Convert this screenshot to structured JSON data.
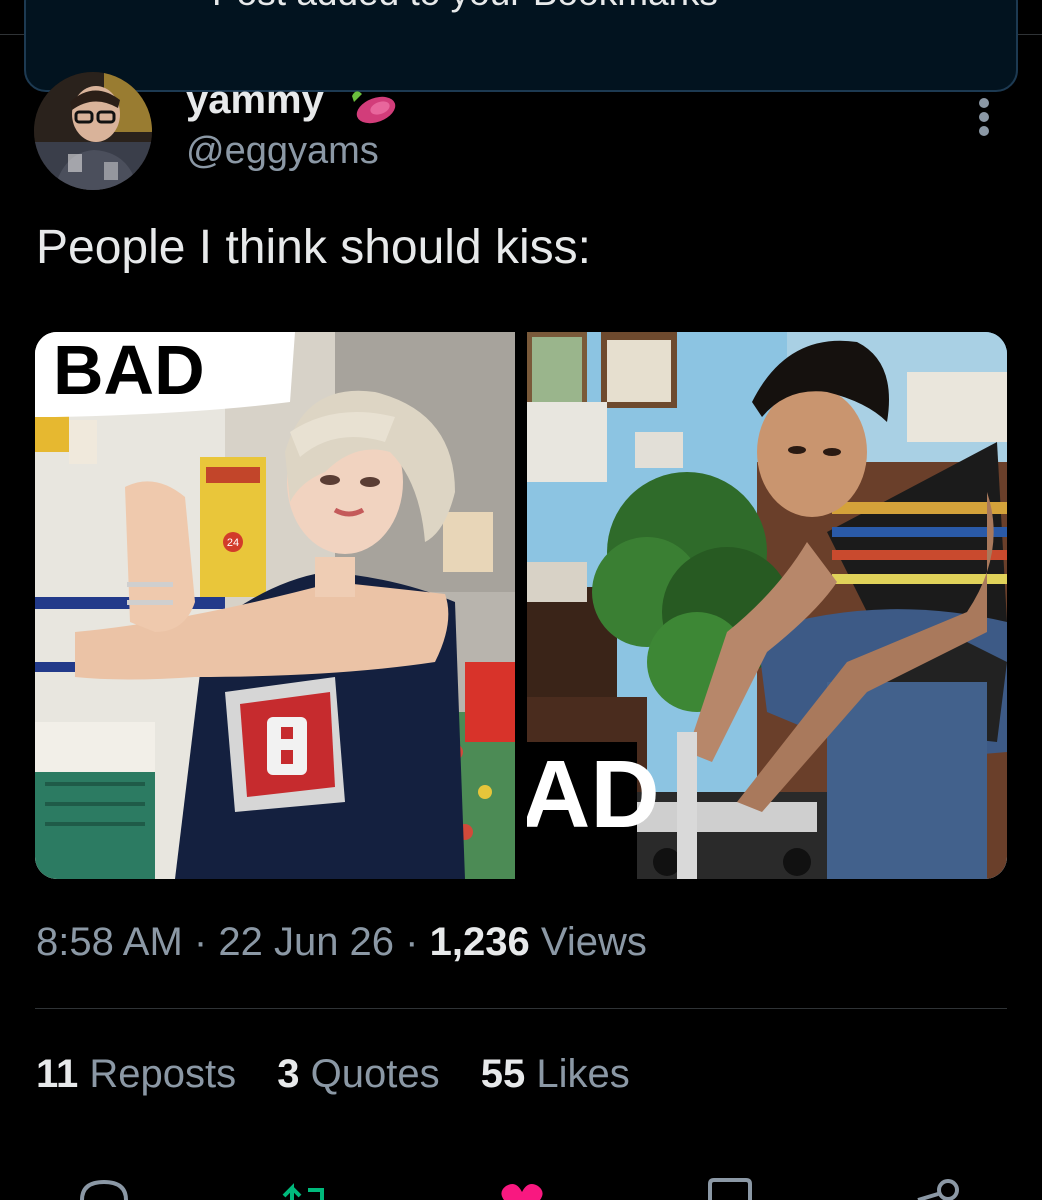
{
  "toast": {
    "message": "Post added to your Bookmarks",
    "icon": "check-circle-icon"
  },
  "author": {
    "display_name": "yammy",
    "name_emoji": "sweet-potato-emoji",
    "handle": "@eggyams"
  },
  "tweet": {
    "text": "People I think should kiss:"
  },
  "media": [
    {
      "overlay_text": "BAD",
      "price_tag": "24"
    },
    {
      "overlay_text": "AD"
    }
  ],
  "meta": {
    "time": "8:58 AM",
    "date": "22 Jun 26",
    "views_count": "1,236",
    "views_label": "Views",
    "separator": "·"
  },
  "stats": [
    {
      "count": "11",
      "label": "Reposts"
    },
    {
      "count": "3",
      "label": "Quotes"
    },
    {
      "count": "55",
      "label": "Likes"
    }
  ],
  "colors": {
    "accent": "#1d9bf0",
    "like": "#f91880",
    "repost": "#00ba7c",
    "muted": "#8b98a5",
    "text": "#e7e9ea"
  }
}
